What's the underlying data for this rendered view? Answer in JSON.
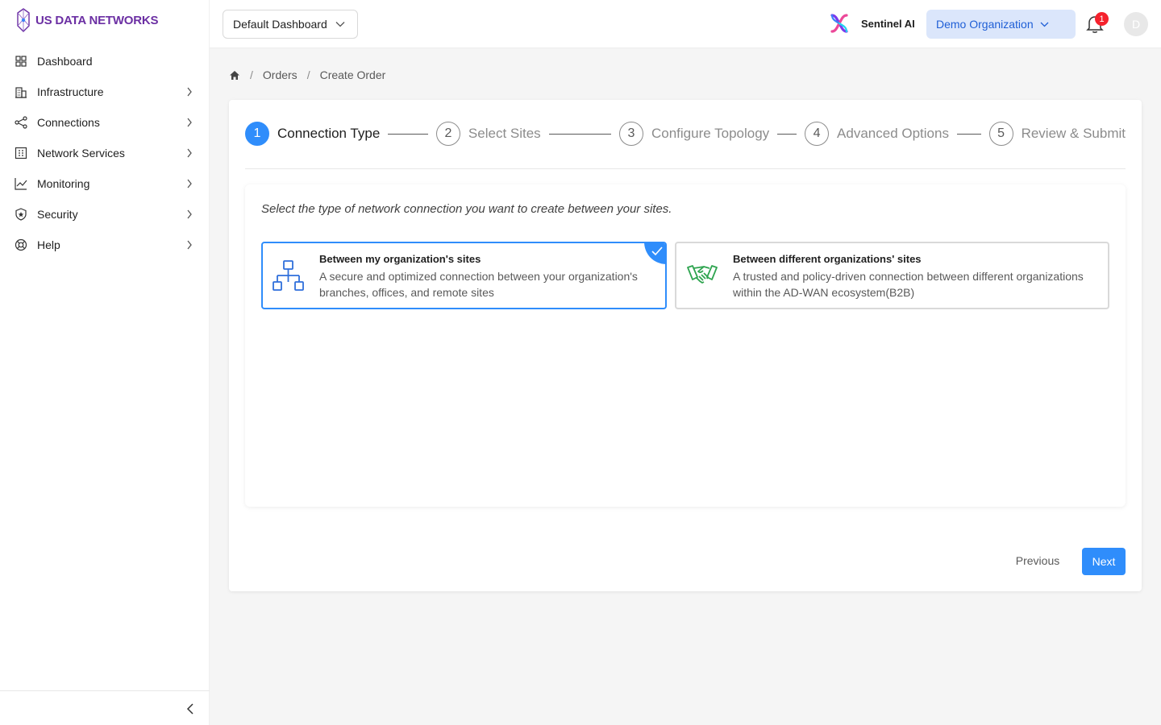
{
  "brand": {
    "name": "US DATA NETWORKS",
    "color": "#6b2fa3"
  },
  "sidebar": {
    "items": [
      {
        "label": "Dashboard",
        "icon": "grid-icon",
        "has_children": false
      },
      {
        "label": "Infrastructure",
        "icon": "building-icon",
        "has_children": true
      },
      {
        "label": "Connections",
        "icon": "share-icon",
        "has_children": true
      },
      {
        "label": "Network Services",
        "icon": "network-services-icon",
        "has_children": true
      },
      {
        "label": "Monitoring",
        "icon": "line-chart-icon",
        "has_children": true
      },
      {
        "label": "Security",
        "icon": "shield-icon",
        "has_children": true
      },
      {
        "label": "Help",
        "icon": "lifebuoy-icon",
        "has_children": true
      }
    ]
  },
  "header": {
    "dashboard_select": "Default Dashboard",
    "sentinel_label": "Sentinel AI",
    "organization": "Demo Organization",
    "notification_count": "1",
    "avatar_initial": "D"
  },
  "breadcrumb": {
    "items": [
      "Orders",
      "Create Order"
    ]
  },
  "wizard": {
    "steps": [
      {
        "num": "1",
        "label": "Connection Type",
        "active": true
      },
      {
        "num": "2",
        "label": "Select Sites",
        "active": false
      },
      {
        "num": "3",
        "label": "Configure Topology",
        "active": false
      },
      {
        "num": "4",
        "label": "Advanced Options",
        "active": false
      },
      {
        "num": "5",
        "label": "Review & Submit",
        "active": false
      }
    ],
    "instruction": "Select the type of network connection you want to create between your sites.",
    "options": [
      {
        "title": "Between my organization's sites",
        "description": "A secure and optimized connection between your organization's branches, offices, and remote sites",
        "selected": true,
        "icon": "org-chart-icon"
      },
      {
        "title": "Between different organizations' sites",
        "description": "A trusted and policy-driven connection between different organizations within the AD-WAN ecosystem(B2B)",
        "selected": false,
        "icon": "handshake-icon"
      }
    ],
    "previous_label": "Previous",
    "next_label": "Next"
  },
  "colors": {
    "primary": "#2f8dfb",
    "org_bg": "#dbe6fb",
    "org_text": "#1f5fd6",
    "badge": "#f5222d",
    "handshake": "#2ea44f"
  }
}
